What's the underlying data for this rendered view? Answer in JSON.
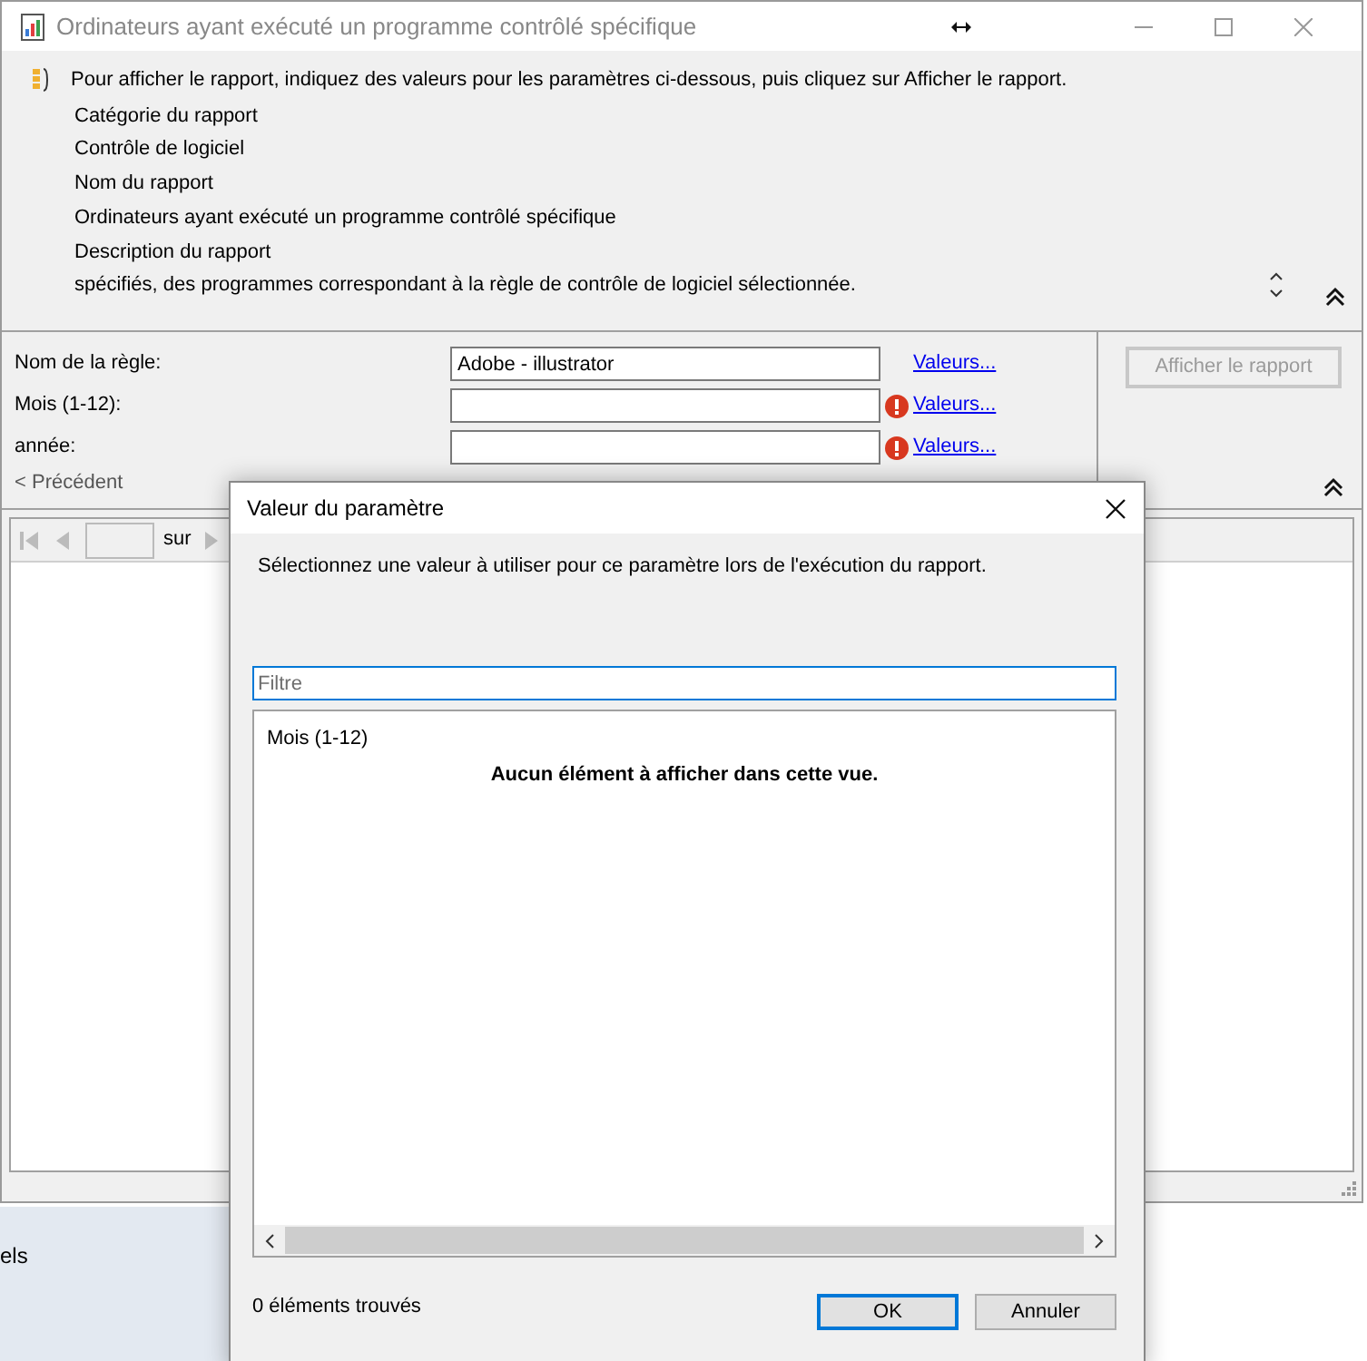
{
  "window": {
    "title": "Ordinateurs ayant exécuté un programme contrôlé spécifique"
  },
  "info": {
    "instruction": "Pour afficher le rapport, indiquez des valeurs pour les paramètres ci-dessous, puis cliquez sur Afficher le rapport.",
    "lines": [
      "Catégorie du rapport",
      "Contrôle de logiciel",
      "Nom du rapport",
      "Ordinateurs ayant exécuté un programme contrôlé spécifique",
      "Description du rapport",
      "spécifiés, des programmes correspondant à la règle de contrôle de logiciel sélectionnée."
    ]
  },
  "parameters": [
    {
      "label": "Nom de la règle:",
      "value": "Adobe - illustrator",
      "error": false,
      "link": "Valeurs..."
    },
    {
      "label": "Mois (1-12):",
      "error": true,
      "link": "Valeurs..."
    },
    {
      "label": "année:",
      "error": true,
      "link": "Valeurs..."
    }
  ],
  "previous_link": "< Précédent",
  "show_report_button": {
    "label": "Afficher le rapport",
    "disabled": true
  },
  "toolbar": {
    "page_label": "sur"
  },
  "background_text": "els",
  "dialog": {
    "title": "Valeur du paramètre",
    "prompt": "Sélectionnez une valeur à utiliser pour ce paramètre lors de l'exécution du rapport.",
    "filter": {
      "placeholder": "Filtre"
    },
    "list_header": "Mois (1-12)",
    "empty_message": "Aucun élément à afficher dans cette vue.",
    "count": "0 éléments trouvés",
    "buttons": [
      {
        "label": "OK",
        "default": true
      },
      {
        "label": "Annuler",
        "default": false
      }
    ]
  }
}
